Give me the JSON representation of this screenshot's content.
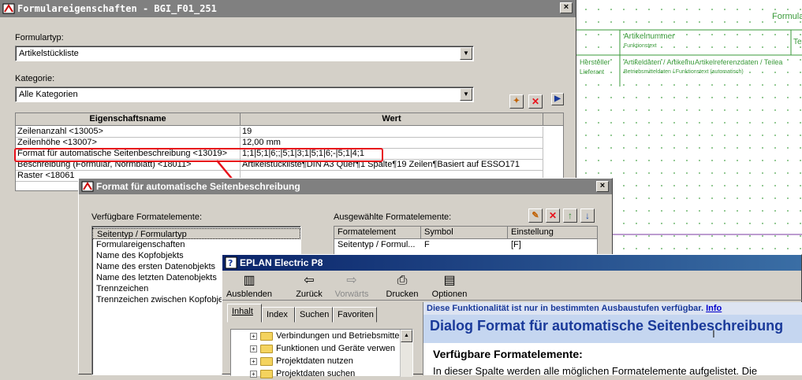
{
  "props_window": {
    "title": "Formulareigenschaften - BGI_F01_251",
    "close_label": "×",
    "form_type_label": "Formulartyp:",
    "form_type_value": "Artikelstückliste",
    "category_label": "Kategorie:",
    "category_value": "Alle Kategorien",
    "col_name": "Eigenschaftsname",
    "col_value": "Wert",
    "rows": [
      {
        "name": "Zeilenanzahl <13005>",
        "value": "19"
      },
      {
        "name": "Zeilenhöhe <13007>",
        "value": "12,00 mm"
      },
      {
        "name": "Format für automatische Seitenbeschreibung <13019>",
        "value": "1;1|5;1|6;;|5;1|3;1|5;1|6;-|5;1|4;1"
      },
      {
        "name": "Beschreibung (Formular, Normblatt) <18011>",
        "value": "Artikelstückliste¶DIN A3 Quer¶1 Spalte¶19 Zeilen¶Basiert auf ESSO171"
      },
      {
        "name": "Raster <18061",
        "value": ""
      }
    ]
  },
  "format_dialog": {
    "title": "Format für automatische Seitenbeschreibung",
    "close_label": "×",
    "available_label": "Verfügbare Formatelemente:",
    "available_items": [
      "Seitentyp / Formulartyp",
      "Formulareigenschaften",
      "Name des Kopfobjekts",
      "Name des ersten Datenobjekts",
      "Name des letzten Datenobjekts",
      "Trennzeichen",
      "Trennzeichen zwischen Kopfobjekt"
    ],
    "selected_label": "Ausgewählte Formatelemente:",
    "selected_cols": [
      "Formatelement",
      "Symbol",
      "Einstellung"
    ],
    "selected_rows": [
      {
        "element": "Seitentyp / Formul...",
        "symbol": "F",
        "setting": "[F]"
      }
    ]
  },
  "background_form": {
    "header_text": "Formular",
    "col1_title": "Artikelnummer",
    "col1_sub": "Funktionstext",
    "col_te": "Te",
    "hersteller": "Hersteller",
    "lieferant": "Lieferant",
    "artikeldaten": "Artikeldaten / Artikelnummer",
    "betriebsmittel": "Betriebsmitteldaten / Funktionstext (automatisch)",
    "artikelref": "Artikelreferenzdaten / Teilea"
  },
  "help_window": {
    "title": "EPLAN Electric P8",
    "toolbar": [
      {
        "label": "Ausblenden",
        "icon": "hide-icon"
      },
      {
        "label": "Zurück",
        "icon": "back-arrow-icon"
      },
      {
        "label": "Vorwärts",
        "icon": "forward-arrow-icon"
      },
      {
        "label": "Drucken",
        "icon": "printer-icon"
      },
      {
        "label": "Optionen",
        "icon": "options-icon"
      }
    ],
    "tabs": [
      "Inhalt",
      "Index",
      "Suchen",
      "Favoriten"
    ],
    "tree": [
      "Verbindungen und Betriebsmittel",
      "Funktionen und Geräte verwen",
      "Projektdaten nutzen",
      "Projektdaten suchen"
    ],
    "notice": "Diese Funktionalität ist nur in bestimmten Ausbaustufen verfügbar.",
    "notice_link": "Info",
    "heading": "Dialog Format für automatische Seitenbeschreibung",
    "subheading": "Verfügbare Formatelemente:",
    "body": "In dieser Spalte werden alle möglichen Formatelemente aufgelistet. Die"
  },
  "colors": {
    "highlight": "#e8101a",
    "title_active": "#0a246a",
    "help_heading": "#1a3a9a"
  }
}
